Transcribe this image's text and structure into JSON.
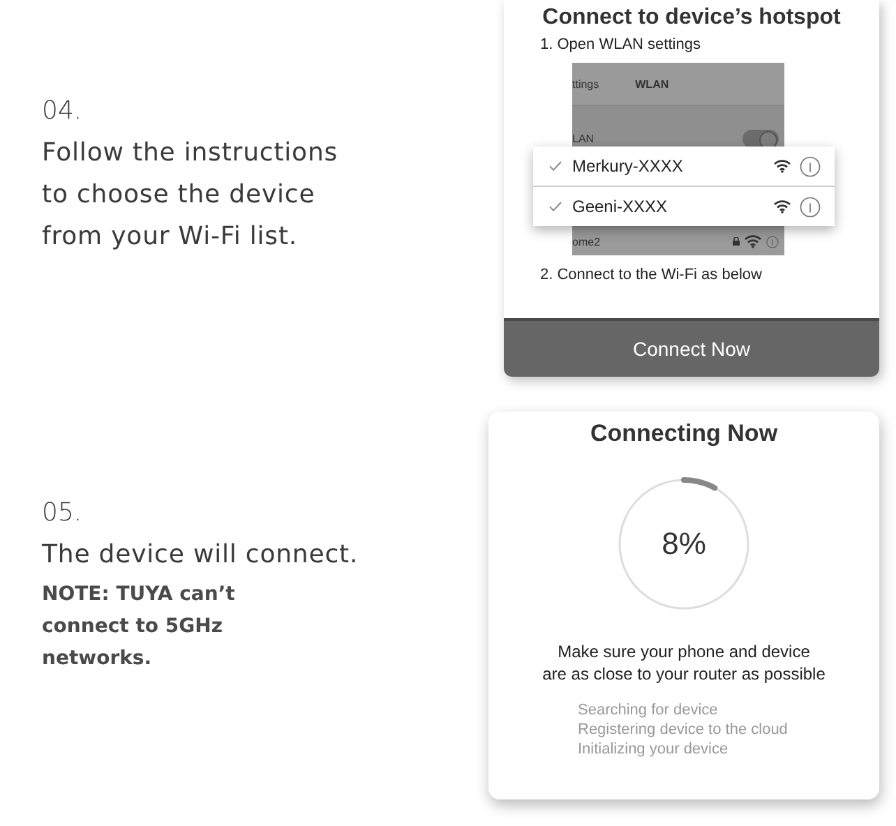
{
  "steps": [
    {
      "number": "04.",
      "lines": [
        "Follow the instructions",
        "to choose the device",
        "from your Wi-Fi list."
      ]
    },
    {
      "number": "05.",
      "lines": [
        "The device will connect."
      ],
      "note_lines": [
        "NOTE: TUYA can’t",
        "connect to 5GHz",
        "networks."
      ]
    }
  ],
  "hotspot_card": {
    "title": "Connect to device’s hotspot",
    "step_1": "1. Open WLAN settings",
    "settings_screen": {
      "back_label": "ttings",
      "title": "WLAN",
      "wlan_label": "LAN",
      "wlan_on": true,
      "other_network": "ome2"
    },
    "networks": [
      {
        "name": "Merkury-XXXX",
        "checked": true
      },
      {
        "name": "Geeni-XXXX",
        "checked": true
      }
    ],
    "step_2": "2. Connect to the Wi-Fi as below",
    "button": "Connect Now"
  },
  "progress_card": {
    "title": "Connecting Now",
    "level": 0.08,
    "reading": "8%",
    "message_lines": [
      "Make sure your phone and device",
      "are as close to your router as possible"
    ],
    "statuses": [
      "Searching for device",
      "Registering device to the cloud",
      "Initializing your device"
    ]
  }
}
